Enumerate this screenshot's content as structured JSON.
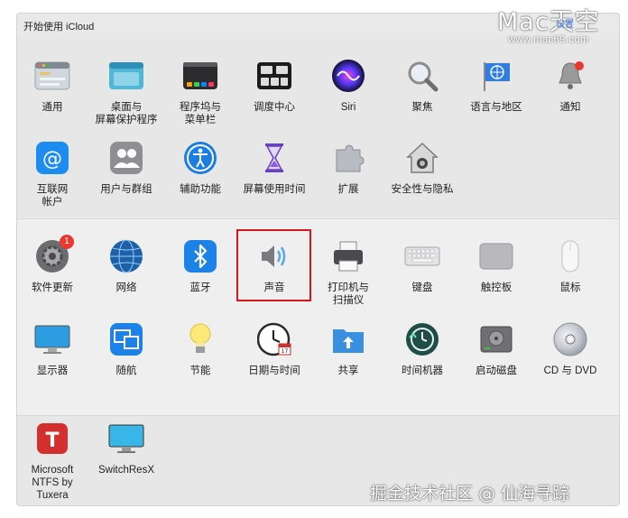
{
  "top_bar": {
    "title": "开始使用 iCloud"
  },
  "watermark": {
    "brand": "Mac天空",
    "url": "www.mac69.com",
    "tag": "设置",
    "bottom": "掘金技术社区 @ 仙海寻踪"
  },
  "sections": [
    {
      "items": [
        {
          "label": "通用",
          "icon": "general-icon"
        },
        {
          "label": "桌面与\n屏幕保护程序",
          "icon": "desktop-icon"
        },
        {
          "label": "程序坞与\n菜单栏",
          "icon": "dock-icon"
        },
        {
          "label": "调度中心",
          "icon": "mission-control-icon"
        },
        {
          "label": "Siri",
          "icon": "siri-icon"
        },
        {
          "label": "聚焦",
          "icon": "spotlight-icon"
        },
        {
          "label": "语言与地区",
          "icon": "language-icon"
        },
        {
          "label": "通知",
          "icon": "notifications-icon"
        },
        {
          "label": "互联网\n帐户",
          "icon": "internet-accounts-icon"
        },
        {
          "label": "用户与群组",
          "icon": "users-icon"
        },
        {
          "label": "辅助功能",
          "icon": "accessibility-icon"
        },
        {
          "label": "屏幕使用时间",
          "icon": "screen-time-icon"
        },
        {
          "label": "扩展",
          "icon": "extensions-icon"
        },
        {
          "label": "安全性与隐私",
          "icon": "security-icon"
        }
      ]
    },
    {
      "items": [
        {
          "label": "软件更新",
          "icon": "software-update-icon",
          "badge": "1"
        },
        {
          "label": "网络",
          "icon": "network-icon"
        },
        {
          "label": "蓝牙",
          "icon": "bluetooth-icon"
        },
        {
          "label": "声音",
          "icon": "sound-icon"
        },
        {
          "label": "打印机与\n扫描仪",
          "icon": "printer-icon"
        },
        {
          "label": "键盘",
          "icon": "keyboard-icon"
        },
        {
          "label": "触控板",
          "icon": "trackpad-icon"
        },
        {
          "label": "鼠标",
          "icon": "mouse-icon"
        },
        {
          "label": "显示器",
          "icon": "display-icon"
        },
        {
          "label": "随航",
          "icon": "sidecar-icon"
        },
        {
          "label": "节能",
          "icon": "energy-icon"
        },
        {
          "label": "日期与时间",
          "icon": "clock-icon"
        },
        {
          "label": "共享",
          "icon": "sharing-icon"
        },
        {
          "label": "时间机器",
          "icon": "time-machine-icon"
        },
        {
          "label": "启动磁盘",
          "icon": "startup-disk-icon"
        },
        {
          "label": "CD 与 DVD",
          "icon": "cd-dvd-icon"
        }
      ]
    },
    {
      "items": [
        {
          "label": "Microsoft\nNTFS by Tuxera",
          "icon": "tuxera-icon"
        },
        {
          "label": "SwitchResX",
          "icon": "switchresx-icon"
        }
      ]
    }
  ],
  "colors": {
    "highlight": "#d9141b",
    "accent_blue": "#1f7ae0"
  }
}
